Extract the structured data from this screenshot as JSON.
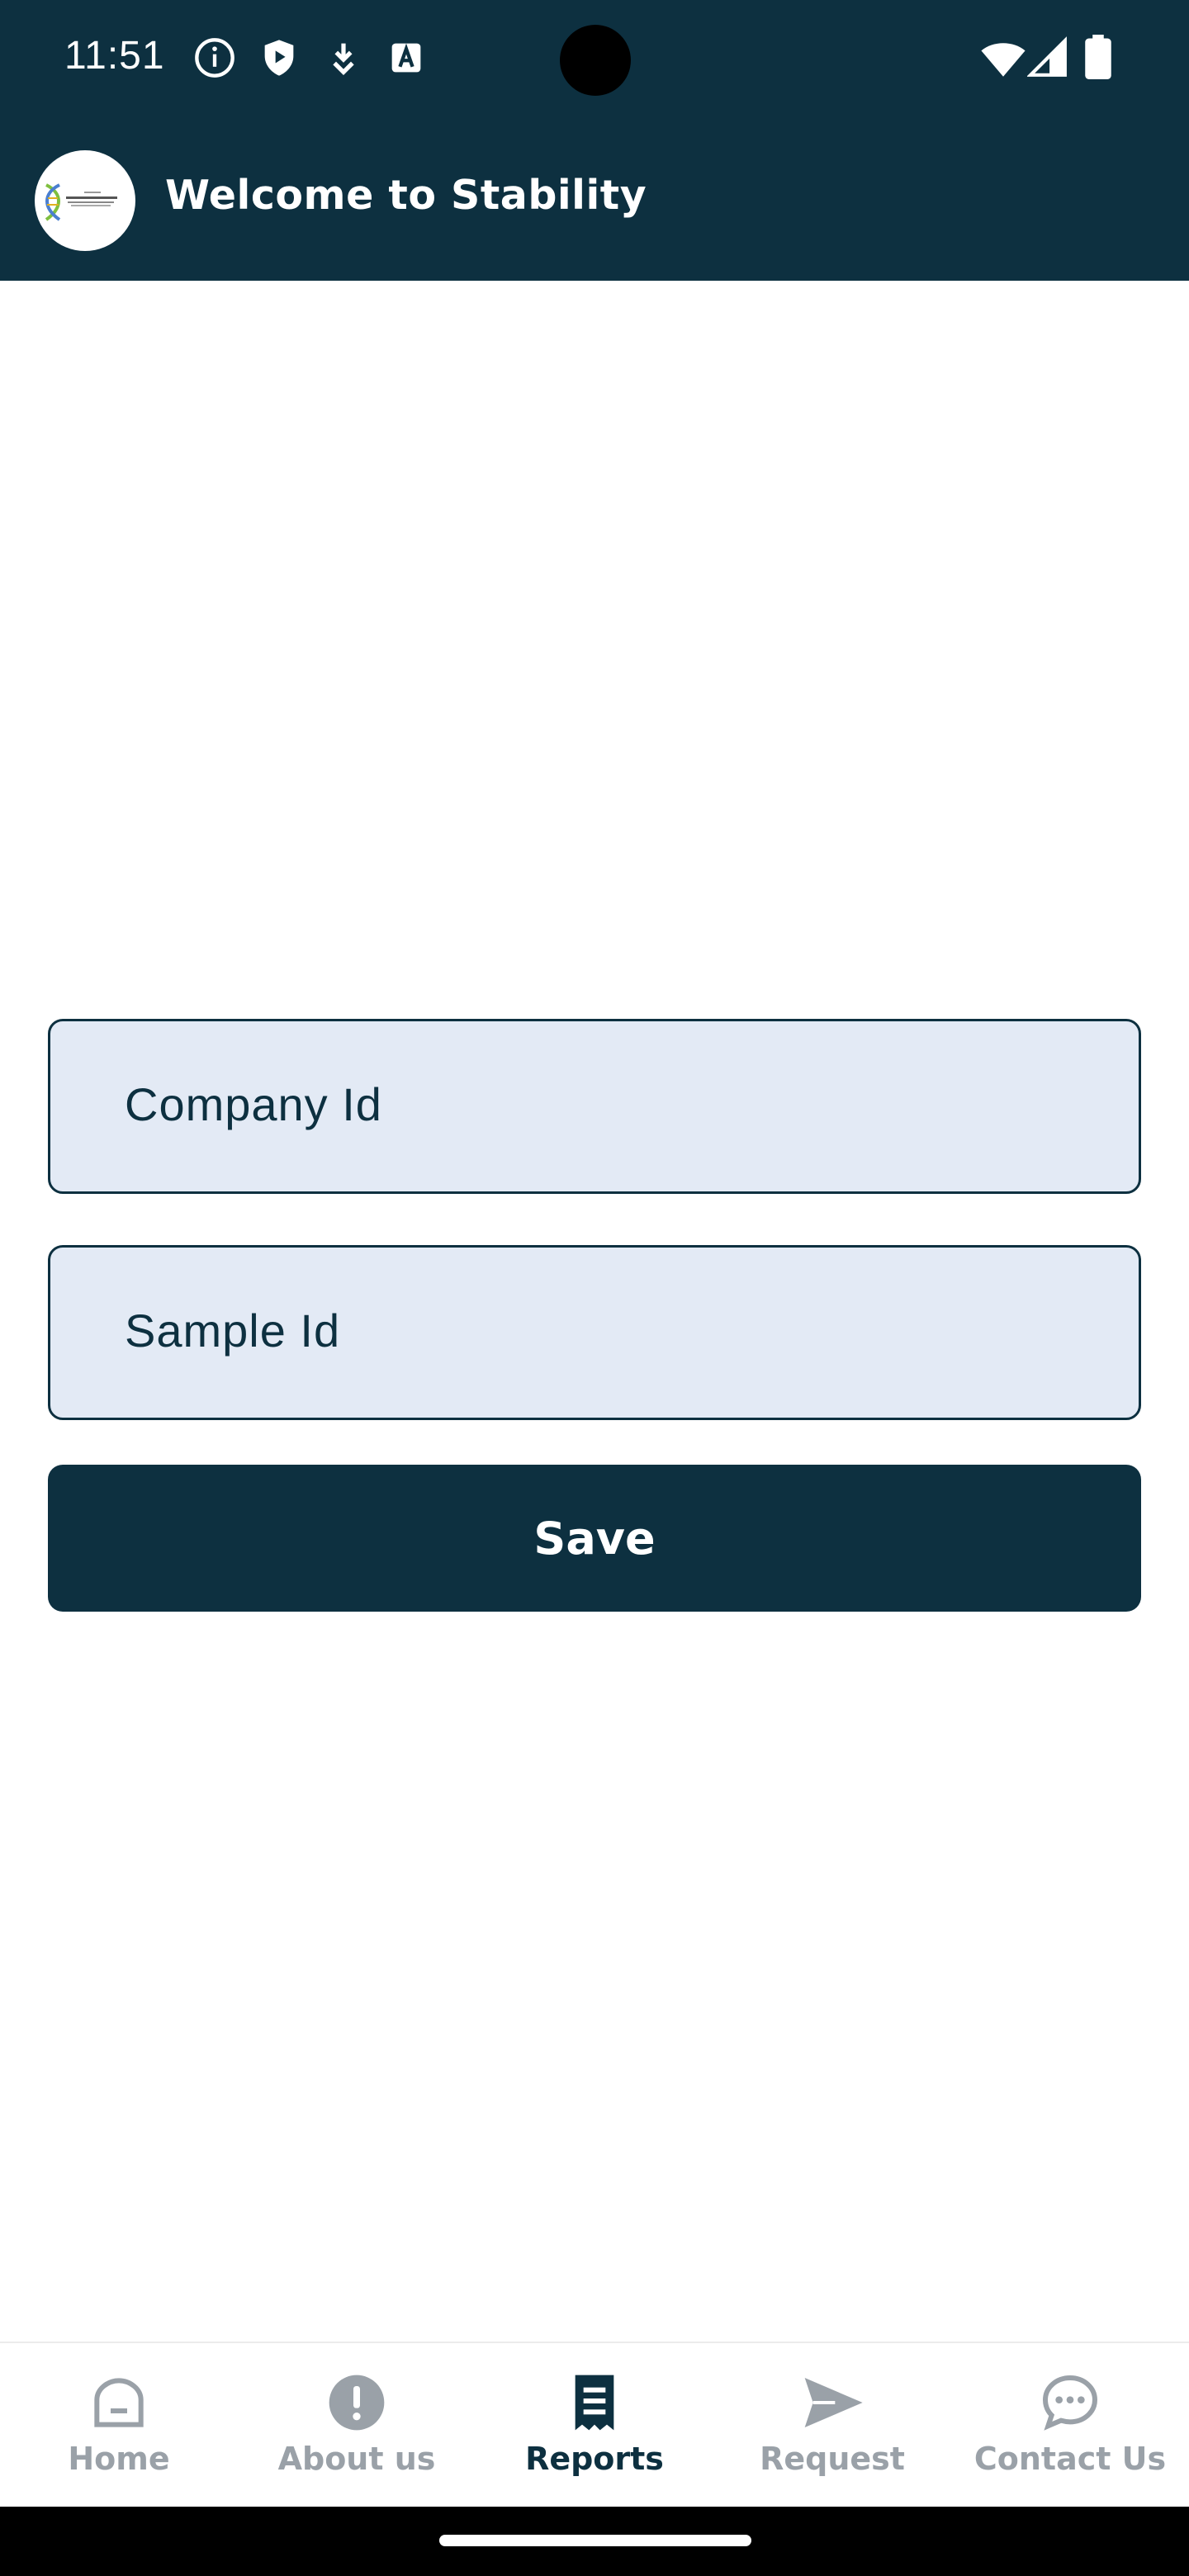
{
  "status_bar": {
    "time": "11:51",
    "icons": [
      "info-icon",
      "shield-play-icon",
      "download-icon",
      "keyboard-a-icon",
      "wifi-icon",
      "signal-icon",
      "battery-icon"
    ]
  },
  "app_bar": {
    "title": "Welcome to Stability",
    "logo": "stability-logo"
  },
  "form": {
    "company_id_placeholder": "Company Id",
    "sample_id_placeholder": "Sample Id",
    "save_label": "Save"
  },
  "bottom_nav": {
    "items": [
      {
        "label": "Home",
        "icon": "home-icon",
        "active": false
      },
      {
        "label": "About us",
        "icon": "exclamation-circle-icon",
        "active": false
      },
      {
        "label": "Reports",
        "icon": "receipt-icon",
        "active": true
      },
      {
        "label": "Request",
        "icon": "send-icon",
        "active": false
      },
      {
        "label": "Contact Us",
        "icon": "chat-bubble-icon",
        "active": false
      }
    ]
  },
  "colors": {
    "primary": "#0d3040",
    "field_background": "#e3eaf5",
    "inactive_nav": "#9aa1a8"
  }
}
